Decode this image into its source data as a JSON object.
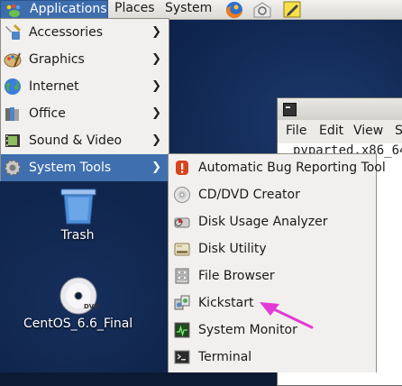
{
  "panel": {
    "applications_label": "Applications",
    "places_label": "Places",
    "system_label": "System"
  },
  "terminal": {
    "menu": [
      "File",
      "Edit",
      "View",
      "S"
    ],
    "line": "pyparted.x86_64"
  },
  "desktop_icons": {
    "trash_label": "Trash",
    "dvd_label": "CentOS_6.6_Final",
    "dvd_badge": "DVD"
  },
  "applications_menu": {
    "items": [
      {
        "label": "Accessories",
        "icon": "accessories-icon"
      },
      {
        "label": "Graphics",
        "icon": "graphics-icon"
      },
      {
        "label": "Internet",
        "icon": "internet-icon"
      },
      {
        "label": "Office",
        "icon": "office-icon"
      },
      {
        "label": "Sound & Video",
        "icon": "sound-video-icon"
      },
      {
        "label": "System Tools",
        "icon": "system-tools-icon",
        "active": true
      }
    ],
    "submenu_arrow": "❯"
  },
  "system_tools_menu": {
    "items": [
      {
        "label": "Automatic Bug Reporting Tool",
        "icon": "bug-reporting-icon"
      },
      {
        "label": "CD/DVD Creator",
        "icon": "disc-icon"
      },
      {
        "label": "Disk Usage Analyzer",
        "icon": "disk-usage-icon"
      },
      {
        "label": "Disk Utility",
        "icon": "disk-utility-icon"
      },
      {
        "label": "File Browser",
        "icon": "file-browser-icon"
      },
      {
        "label": "Kickstart",
        "icon": "kickstart-icon"
      },
      {
        "label": "System Monitor",
        "icon": "system-monitor-icon"
      },
      {
        "label": "Terminal",
        "icon": "terminal-icon"
      }
    ]
  },
  "colors": {
    "menu_highlight": "#3f6fae",
    "annotation_arrow": "#e23ad6"
  }
}
